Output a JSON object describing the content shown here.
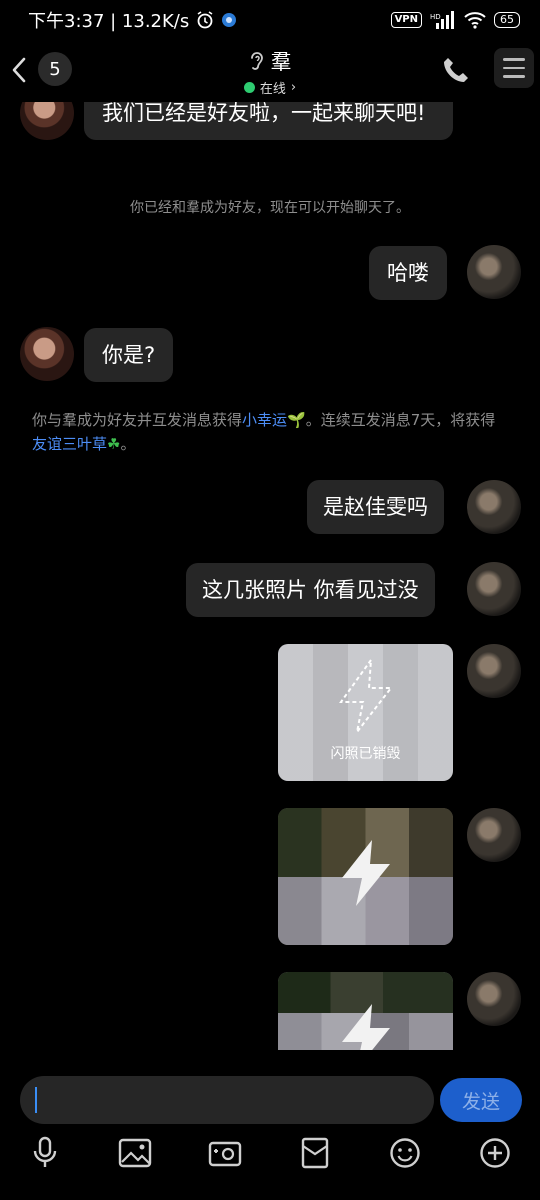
{
  "status_bar": {
    "time_speed": "下午3:37 | 13.2K/s",
    "vpn": "VPN",
    "battery": "65"
  },
  "header": {
    "unread_count": "5",
    "title": "羣",
    "status": "在线",
    "status_chevron": "›"
  },
  "messages": {
    "m1": "我们已经是好友啦，一起来聊天吧!",
    "sys1": "你已经和羣成为好友，现在可以开始聊天了。",
    "m2": "哈喽",
    "m3": "你是?",
    "sys2_part1": "你与羣成为好友并互发消息获得",
    "sys2_link1": "小幸运",
    "sys2_emoji1": "🌱",
    "sys2_part2": "。连续互发消息7天，将获得",
    "sys2_link2": "友谊三叶草",
    "sys2_emoji2": "☘",
    "sys2_part3": "。",
    "m4": "是赵佳雯吗",
    "m5": "这几张照片 你看见过没",
    "photo1_label": "闪照已销毁"
  },
  "input": {
    "send_label": "发送"
  },
  "icons": {
    "back": "chevron-left-icon",
    "ear": "ear-icon",
    "phone": "phone-icon",
    "menu": "menu-icon",
    "flash": "lightning-icon",
    "mic": "microphone-icon",
    "image": "image-icon",
    "camera": "camera-icon",
    "redpacket": "red-packet-icon",
    "emoji": "emoji-icon",
    "plus": "plus-circle-icon"
  },
  "colors": {
    "background": "#000000",
    "bubble": "#262626",
    "link": "#4d8ef7",
    "online": "#2ecc71",
    "send_button": "#1d5fcc"
  }
}
